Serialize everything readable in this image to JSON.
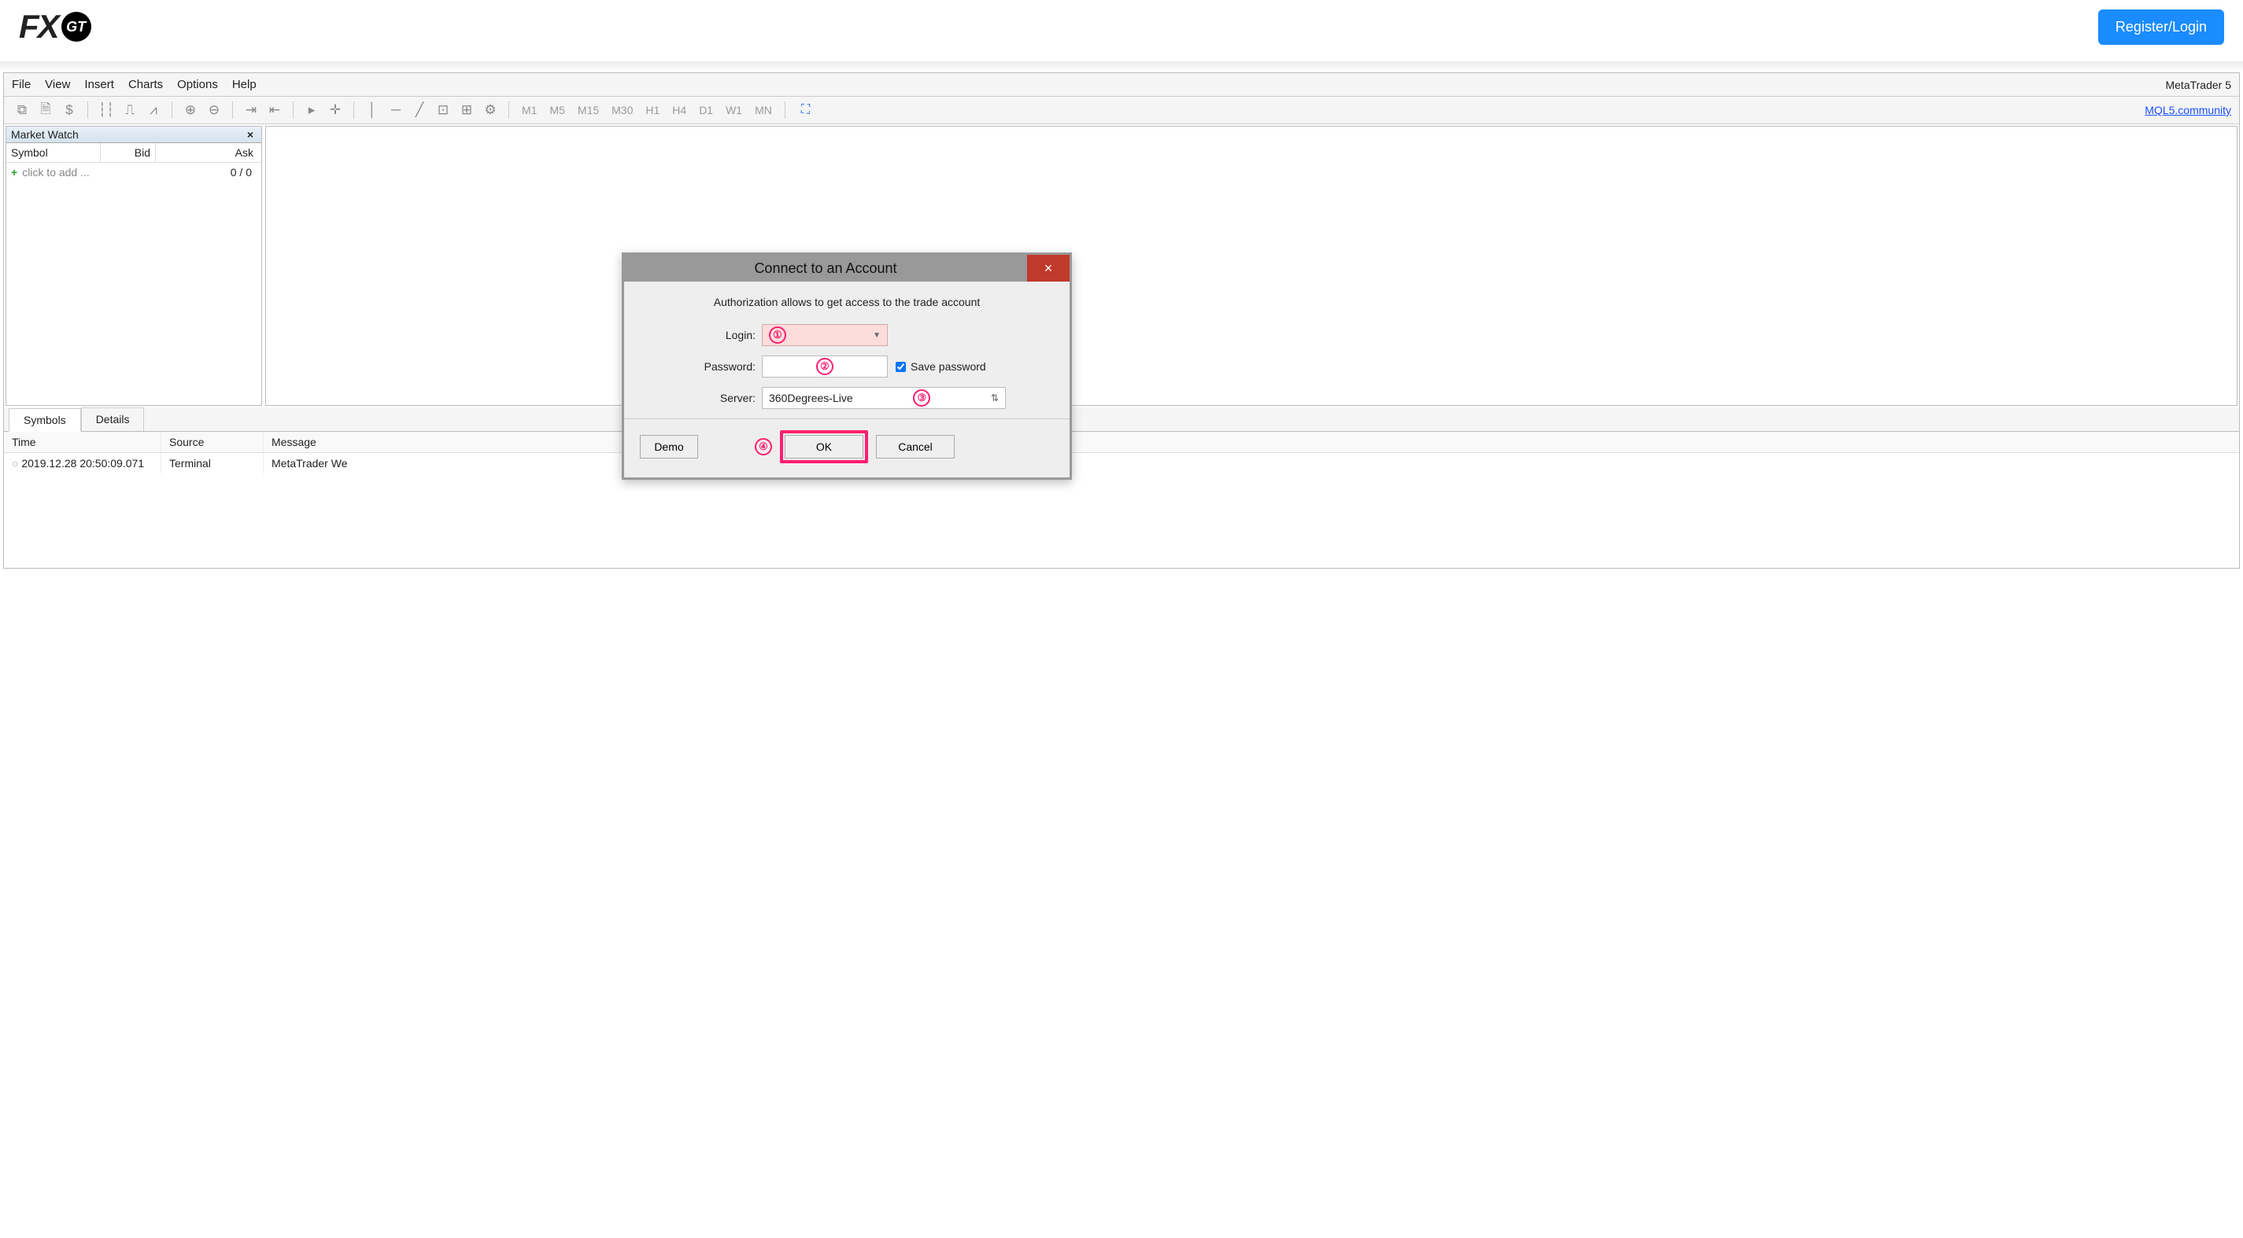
{
  "header": {
    "logo_fx": "FX",
    "logo_gt": "GT",
    "register_btn": "Register/Login"
  },
  "menu": {
    "items": [
      "File",
      "View",
      "Insert",
      "Charts",
      "Options",
      "Help"
    ],
    "app_name": "MetaTrader 5"
  },
  "toolbar": {
    "timeframes": [
      "M1",
      "M5",
      "M15",
      "M30",
      "H1",
      "H4",
      "D1",
      "W1",
      "MN"
    ],
    "mql_link": "MQL5.community"
  },
  "market_watch": {
    "title": "Market Watch",
    "cols": {
      "symbol": "Symbol",
      "bid": "Bid",
      "ask": "Ask"
    },
    "add_label": "click to add ...",
    "add_value": "0 / 0"
  },
  "lower_tabs": {
    "symbols": "Symbols",
    "details": "Details"
  },
  "journal": {
    "cols": {
      "time": "Time",
      "source": "Source",
      "message": "Message"
    },
    "rows": [
      {
        "time": "2019.12.28 20:50:09.071",
        "source": "Terminal",
        "message": "MetaTrader We"
      }
    ]
  },
  "modal": {
    "title": "Connect to an Account",
    "subtitle": "Authorization allows to get access to the trade account",
    "labels": {
      "login": "Login:",
      "password": "Password:",
      "server": "Server:",
      "save_pwd": "Save password"
    },
    "server_value": "360Degrees-Live",
    "buttons": {
      "demo": "Demo",
      "ok": "OK",
      "cancel": "Cancel"
    },
    "callouts": {
      "login": "①",
      "password": "②",
      "server": "③",
      "ok": "④"
    }
  }
}
